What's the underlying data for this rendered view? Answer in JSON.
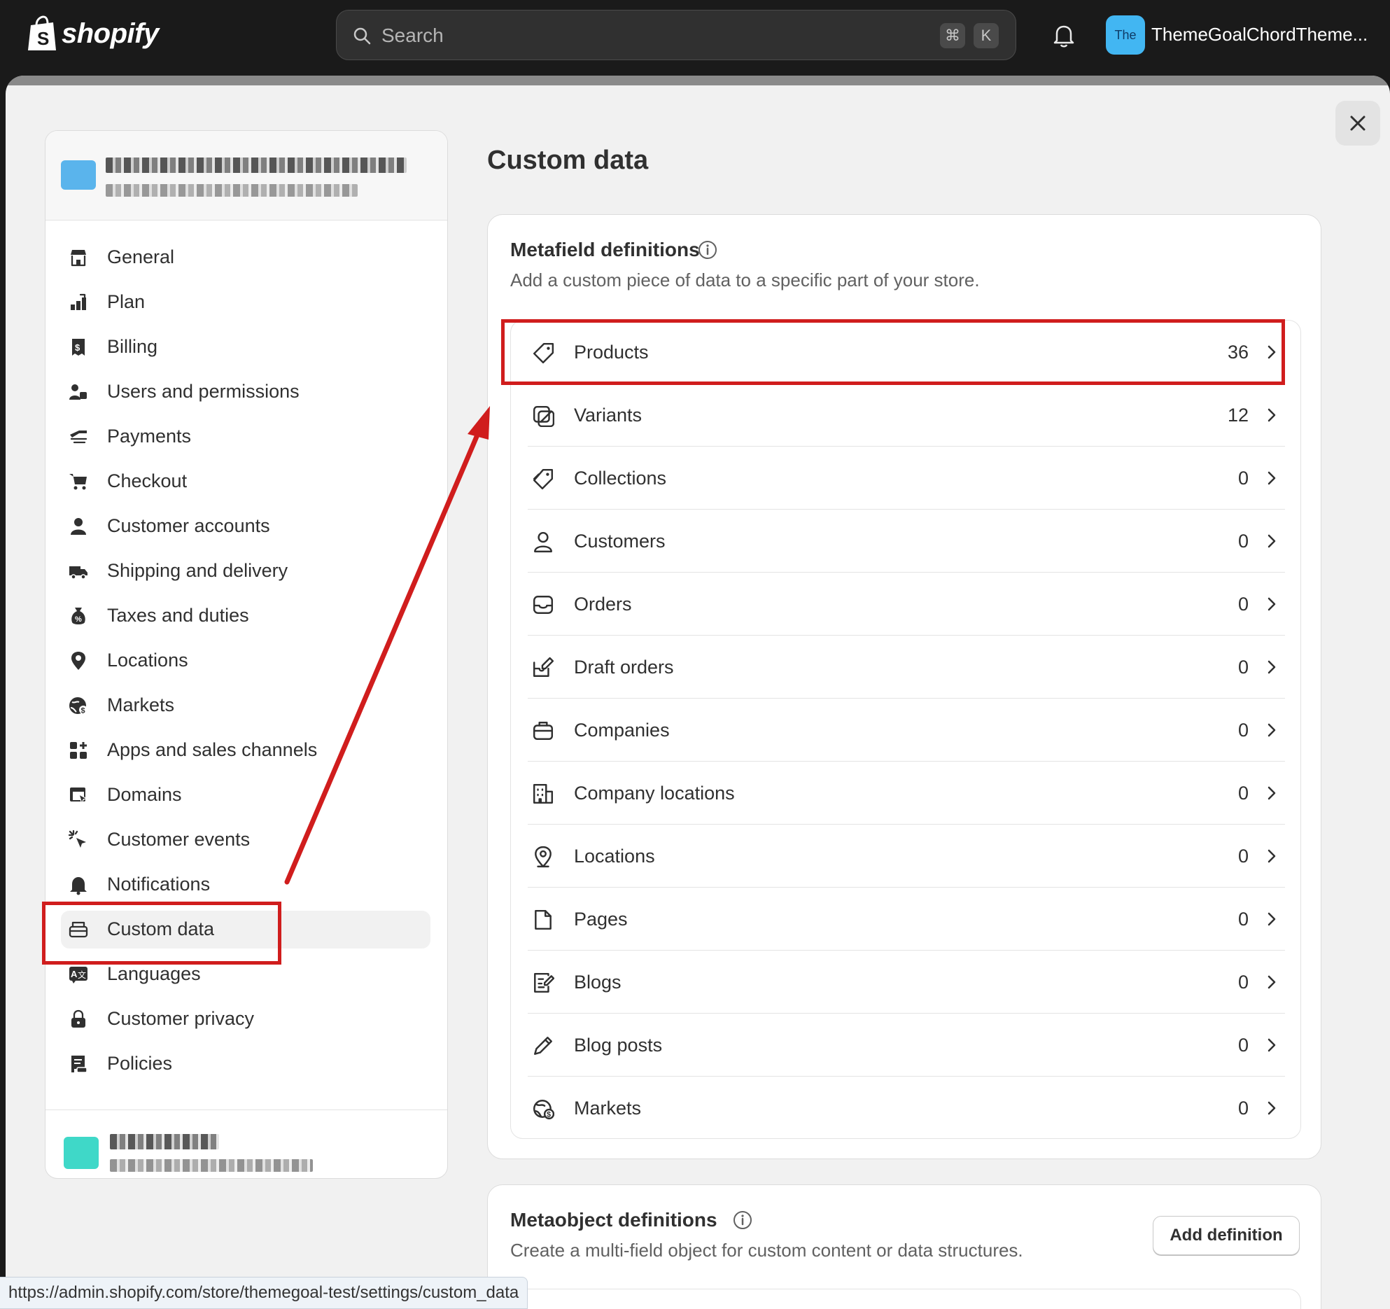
{
  "topbar": {
    "brand": "shopify",
    "search_placeholder": "Search",
    "shortcut_cmd": "⌘",
    "shortcut_key": "K",
    "store_avatar": "The",
    "store_name": "ThemeGoalChordTheme..."
  },
  "sidebar": {
    "items": [
      {
        "label": "General",
        "icon": "store-icon"
      },
      {
        "label": "Plan",
        "icon": "plan-icon"
      },
      {
        "label": "Billing",
        "icon": "billing-icon"
      },
      {
        "label": "Users and permissions",
        "icon": "users-icon"
      },
      {
        "label": "Payments",
        "icon": "payments-icon"
      },
      {
        "label": "Checkout",
        "icon": "cart-icon"
      },
      {
        "label": "Customer accounts",
        "icon": "person-icon"
      },
      {
        "label": "Shipping and delivery",
        "icon": "truck-icon"
      },
      {
        "label": "Taxes and duties",
        "icon": "tax-icon"
      },
      {
        "label": "Locations",
        "icon": "location-icon"
      },
      {
        "label": "Markets",
        "icon": "globe-icon"
      },
      {
        "label": "Apps and sales channels",
        "icon": "apps-icon"
      },
      {
        "label": "Domains",
        "icon": "domains-icon"
      },
      {
        "label": "Customer events",
        "icon": "cursor-icon"
      },
      {
        "label": "Notifications",
        "icon": "bell-icon"
      },
      {
        "label": "Custom data",
        "icon": "custom-data-icon",
        "active": true
      },
      {
        "label": "Languages",
        "icon": "translate-icon"
      },
      {
        "label": "Customer privacy",
        "icon": "lock-icon"
      },
      {
        "label": "Policies",
        "icon": "policy-icon"
      }
    ]
  },
  "main": {
    "title": "Custom data",
    "metafields": {
      "title": "Metafield definitions",
      "subtitle": "Add a custom piece of data to a specific part of your store.",
      "rows": [
        {
          "label": "Products",
          "count": "36",
          "icon": "tag-icon"
        },
        {
          "label": "Variants",
          "count": "12",
          "icon": "variant-icon"
        },
        {
          "label": "Collections",
          "count": "0",
          "icon": "collection-icon"
        },
        {
          "label": "Customers",
          "count": "0",
          "icon": "person-outline-icon"
        },
        {
          "label": "Orders",
          "count": "0",
          "icon": "inbox-icon"
        },
        {
          "label": "Draft orders",
          "count": "0",
          "icon": "draft-icon"
        },
        {
          "label": "Companies",
          "count": "0",
          "icon": "briefcase-icon"
        },
        {
          "label": "Company locations",
          "count": "0",
          "icon": "building-icon"
        },
        {
          "label": "Locations",
          "count": "0",
          "icon": "pin-outline-icon"
        },
        {
          "label": "Pages",
          "count": "0",
          "icon": "page-icon"
        },
        {
          "label": "Blogs",
          "count": "0",
          "icon": "blog-icon"
        },
        {
          "label": "Blog posts",
          "count": "0",
          "icon": "pencil-icon"
        },
        {
          "label": "Markets",
          "count": "0",
          "icon": "globe-outline-icon"
        }
      ]
    },
    "metaobjects": {
      "title": "Metaobject definitions",
      "subtitle": "Create a multi-field object for custom content or data structures.",
      "button": "Add definition"
    }
  },
  "statusbar": {
    "url": "https://admin.shopify.com/store/themegoal-test/settings/custom_data"
  },
  "colors": {
    "highlight": "#d01d1d",
    "topbar": "#1a1a1a",
    "store_avatar": "#42b6f2"
  }
}
